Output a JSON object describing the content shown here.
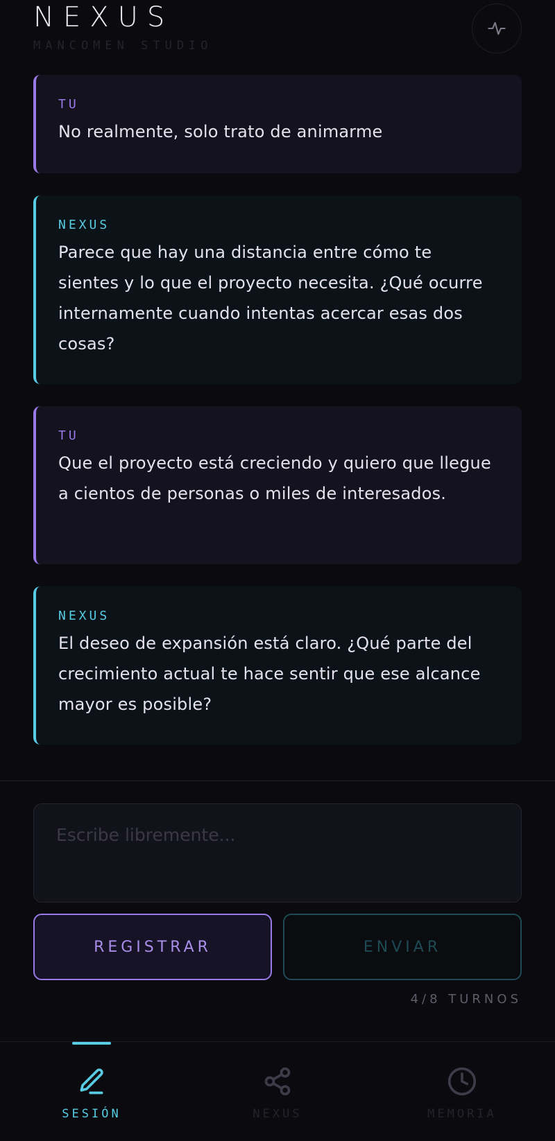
{
  "header": {
    "title": "NEXUS",
    "subtitle": "MANCOMEN STUDIO",
    "activity_icon": "activity-pulse-icon"
  },
  "messages": [
    {
      "role": "user",
      "label": "TU",
      "text": "No realmente, solo trato de animarme"
    },
    {
      "role": "nexus",
      "label": "NEXUS",
      "text": "Parece que hay una distancia entre cómo te sientes y lo que el proyecto necesita. ¿Qué ocurre internamente cuando intentas acercar esas dos cosas?"
    },
    {
      "role": "user",
      "label": "TU",
      "text": "Que el proyecto está creciendo y quiero que llegue a cientos de personas o miles de interesados."
    },
    {
      "role": "nexus",
      "label": "NEXUS",
      "text": "El deseo de expansión está claro. ¿Qué parte del crecimiento actual te hace sentir que ese alcance mayor es posible?"
    }
  ],
  "composer": {
    "placeholder": "Escribe libremente...",
    "value": "",
    "register_label": "REGISTRAR",
    "send_label": "ENVIAR",
    "turns_label": "4/8 TURNOS"
  },
  "nav": {
    "items": [
      {
        "label": "SESIÓN",
        "icon": "pencil-icon",
        "active": true
      },
      {
        "label": "NEXUS",
        "icon": "share-icon",
        "active": false
      },
      {
        "label": "MEMORIA",
        "icon": "clock-icon",
        "active": false
      }
    ]
  },
  "colors": {
    "background": "#0a0a0f",
    "user_accent": "#9a7ae8",
    "nexus_accent": "#57cce2",
    "send_disabled": "#1e4a54"
  }
}
